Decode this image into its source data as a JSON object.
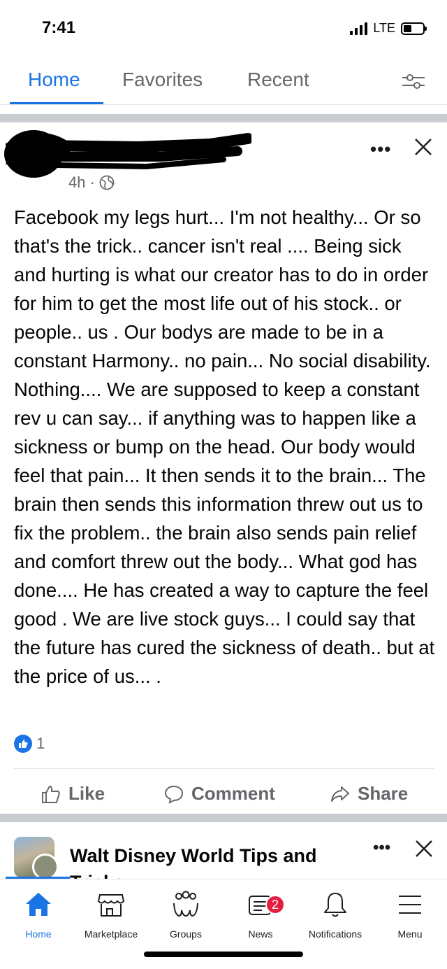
{
  "status_bar": {
    "time": "7:41",
    "network": "LTE"
  },
  "top_tabs": [
    {
      "label": "Home",
      "active": true
    },
    {
      "label": "Favorites",
      "active": false
    },
    {
      "label": "Recent",
      "active": false
    }
  ],
  "post": {
    "time": "4h",
    "privacy_icon": "globe-icon",
    "body": "Facebook my legs hurt... I'm not healthy... Or so that's the trick.. cancer isn't real .... Being sick and hurting is what our creator has to do in order for him to get the most life out of his stock.. or people.. us . Our bodys are made to be in a constant Harmony.. no pain... No social disability. Nothing.... We are supposed to keep a constant rev u can say... if anything was to happen like a sickness or bump on the head. Our body would feel that pain... It then sends it to the brain... The brain then sends this information threw out us to fix the problem.. the brain also sends pain relief and comfort threw out the body... What god has done.... He has created a way to capture the feel good . We are live stock guys... I could say that the future has cured the sickness of death.. but at the price of us... .",
    "reaction_count": "1",
    "actions": {
      "like": "Like",
      "comment": "Comment",
      "share": "Share"
    }
  },
  "next_post": {
    "group_name": "Walt Disney World Tips and Tricks"
  },
  "bottom_nav": [
    {
      "label": "Home",
      "icon": "home-icon",
      "active": true
    },
    {
      "label": "Marketplace",
      "icon": "marketplace-icon"
    },
    {
      "label": "Groups",
      "icon": "groups-icon"
    },
    {
      "label": "News",
      "icon": "news-icon",
      "badge": "2"
    },
    {
      "label": "Notifications",
      "icon": "bell-icon"
    },
    {
      "label": "Menu",
      "icon": "menu-icon"
    }
  ],
  "colors": {
    "accent": "#1b74e4",
    "badge": "#e41e3f",
    "muted": "#65676b",
    "separator": "#c9ccd1"
  }
}
